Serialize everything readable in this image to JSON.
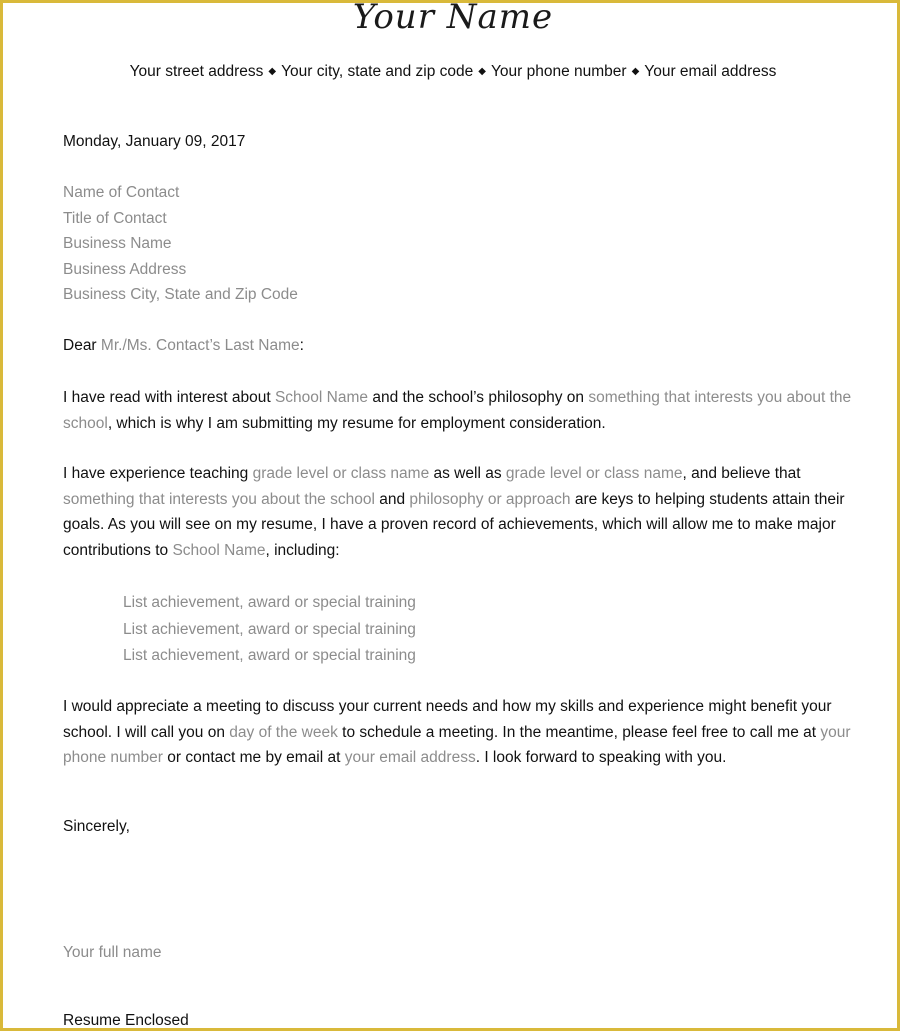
{
  "header": {
    "name": "Your Name",
    "contact": {
      "street": "Your street address",
      "city": "Your city, state and zip code",
      "phone": "Your phone number",
      "email": "Your email address",
      "separator": "◆"
    }
  },
  "date": "Monday, January 09, 2017",
  "recipient": {
    "name": "Name of Contact",
    "title": "Title of Contact",
    "business": "Business Name",
    "address": "Business Address",
    "city": "Business City, State and Zip Code"
  },
  "greeting": {
    "salutation": "Dear",
    "name": "Mr./Ms. Contact’s Last Name",
    "punct": ":"
  },
  "para1": {
    "t1": "I have read with interest about ",
    "p1": "School Name",
    "t2": " and the school’s philosophy on ",
    "p2": "something that interests you about the school",
    "t3": ", which is why I am submitting my resume for employment consideration."
  },
  "para2": {
    "t1": "I have experience teaching ",
    "p1": "grade level or class name",
    "t2": " as well as ",
    "p2": "grade level or class name",
    "t3": ", and believe that ",
    "p3": "something that interests you about the school",
    "t4": " and ",
    "p4": "philosophy or approach",
    "t5": " are keys to helping students attain their goals. As you will see on my resume, I have a proven record of achievements, which will allow me to make major contributions to ",
    "p5": "School Name",
    "t6": ", including:"
  },
  "achievements": [
    "List achievement, award or special training",
    "List achievement, award or special training",
    "List achievement, award or special training"
  ],
  "para3": {
    "t1": "I would appreciate a meeting to discuss your current needs and how my skills and experience might benefit your school. I will call you on ",
    "p1": "day of the week",
    "t2": " to schedule a meeting. In the meantime, please feel free to call me at ",
    "p2": "your phone number",
    "t3": " or contact me by email at ",
    "p3": "your email address",
    "t4": ". I look forward to speaking with you."
  },
  "closing": "Sincerely,",
  "signature": "Your full name",
  "enclosure": "Resume Enclosed",
  "colors": {
    "border": "#d9b93a",
    "placeholder": "#8c8c8c",
    "text": "#111111"
  }
}
